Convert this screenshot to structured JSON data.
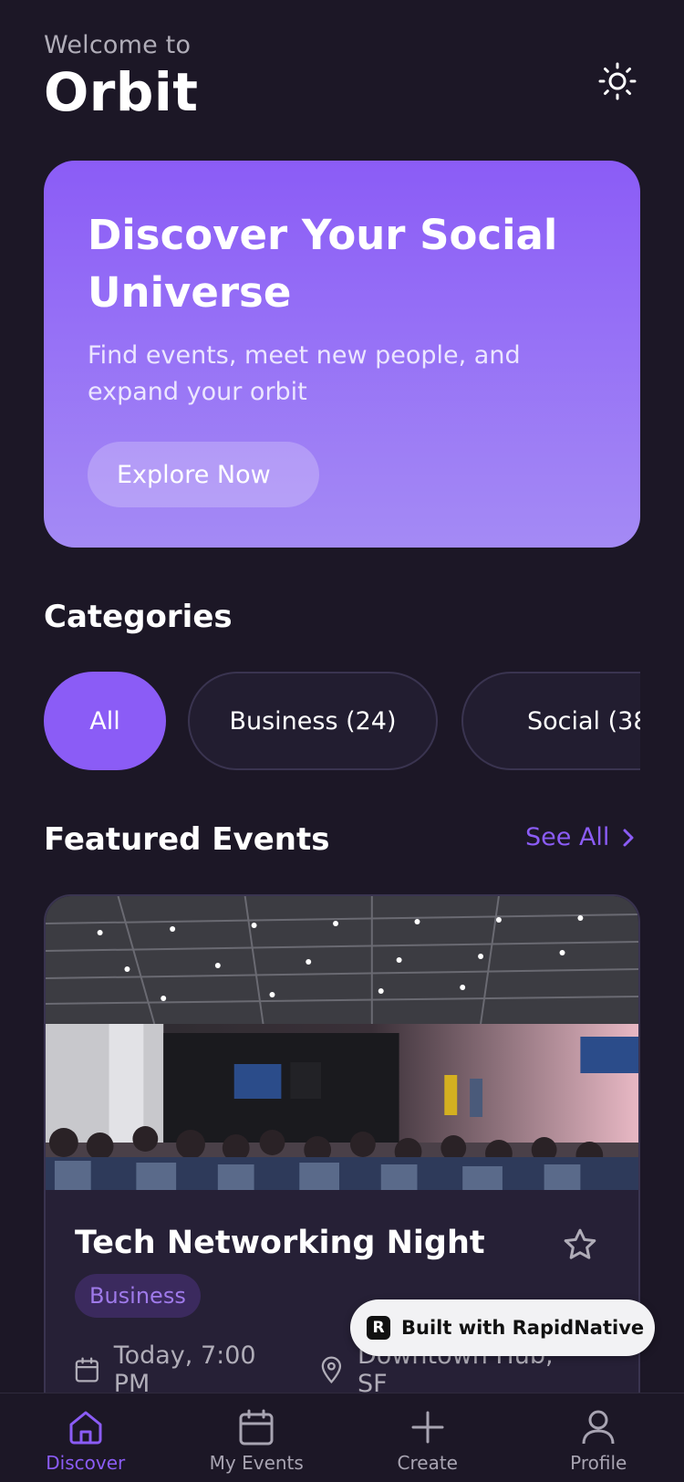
{
  "header": {
    "welcome": "Welcome to",
    "title": "Orbit",
    "theme_icon": "sun-icon"
  },
  "hero": {
    "title": "Discover Your Social Universe",
    "subtitle": "Find events, meet new people, and expand your orbit",
    "button": "Explore Now"
  },
  "categories": {
    "title": "Categories",
    "chips": [
      {
        "label": "All",
        "active": true
      },
      {
        "label": "Business (24)",
        "active": false
      },
      {
        "label": "Social (38",
        "active": false
      }
    ]
  },
  "featured": {
    "title": "Featured Events",
    "see_all": "See All",
    "event": {
      "title": "Tech Networking Night",
      "tag": "Business",
      "date": "Today, 7:00 PM",
      "location": "Downtown Hub, SF"
    }
  },
  "badge": {
    "logo": "R",
    "label": "Built with RapidNative"
  },
  "tabs": [
    {
      "label": "Discover",
      "icon": "home-icon",
      "active": true
    },
    {
      "label": "My Events",
      "icon": "calendar-icon",
      "active": false
    },
    {
      "label": "Create",
      "icon": "plus-icon",
      "active": false
    },
    {
      "label": "Profile",
      "icon": "user-icon",
      "active": false
    }
  ],
  "colors": {
    "background": "#1c1726",
    "accent": "#8b5cf6",
    "card": "#262036",
    "muted_text": "#b0adb8"
  }
}
